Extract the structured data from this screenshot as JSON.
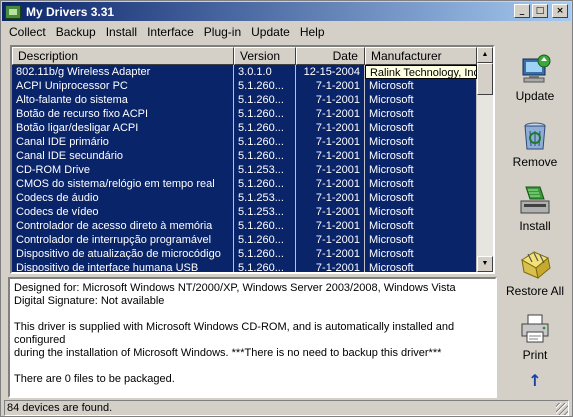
{
  "window": {
    "title": "My Drivers 3.31",
    "buttons": {
      "minimize": "_",
      "maximize": "□",
      "close": "×"
    }
  },
  "menu": [
    {
      "label": "Collect"
    },
    {
      "label": "Backup"
    },
    {
      "label": "Install"
    },
    {
      "label": "Interface"
    },
    {
      "label": "Plug-in"
    },
    {
      "label": "Update"
    },
    {
      "label": "Help"
    }
  ],
  "table": {
    "headers": [
      "Description",
      "Version",
      "Date",
      "Manufacturer"
    ],
    "rows": [
      [
        "802.11b/g Wireless Adapter",
        "3.0.1.0",
        "12-15-2004",
        "Ralink Technology, Inc."
      ],
      [
        "ACPI Uniprocessor PC",
        "5.1.260...",
        "7-1-2001",
        "Microsoft"
      ],
      [
        "Alto-falante do sistema",
        "5.1.260...",
        "7-1-2001",
        "Microsoft"
      ],
      [
        "Botão de recurso fixo ACPI",
        "5.1.260...",
        "7-1-2001",
        "Microsoft"
      ],
      [
        "Botão ligar/desligar ACPI",
        "5.1.260...",
        "7-1-2001",
        "Microsoft"
      ],
      [
        "Canal IDE primário",
        "5.1.260...",
        "7-1-2001",
        "Microsoft"
      ],
      [
        "Canal IDE secundário",
        "5.1.260...",
        "7-1-2001",
        "Microsoft"
      ],
      [
        "CD-ROM Drive",
        "5.1.253...",
        "7-1-2001",
        "Microsoft"
      ],
      [
        "CMOS do sistema/relógio em tempo real",
        "5.1.260...",
        "7-1-2001",
        "Microsoft"
      ],
      [
        "Codecs de áudio",
        "5.1.253...",
        "7-1-2001",
        "Microsoft"
      ],
      [
        "Codecs de vídeo",
        "5.1.253...",
        "7-1-2001",
        "Microsoft"
      ],
      [
        "Controlador de acesso direto à memória",
        "5.1.260...",
        "7-1-2001",
        "Microsoft"
      ],
      [
        "Controlador de interrupção programável",
        "5.1.260...",
        "7-1-2001",
        "Microsoft"
      ],
      [
        "Dispositivo de atualização de microcódigo",
        "5.1.260...",
        "7-1-2001",
        "Microsoft"
      ],
      [
        "Dispositivo de interface humana USB",
        "5.1.260...",
        "7-1-2001",
        "Microsoft"
      ]
    ]
  },
  "details": {
    "designed_for": "Designed for: Microsoft Windows NT/2000/XP, Windows Server 2003/2008, Windows Vista",
    "signature": "Digital Signature: Not available",
    "note_line1": "This driver is supplied with Microsoft Windows CD-ROM, and is automatically installed and configured",
    "note_line2": "during the installation of Microsoft Windows. ***There is no need to backup this driver***",
    "files": "There are 0 files to be packaged."
  },
  "toolbar": {
    "update": "Update",
    "remove": "Remove",
    "install": "Install",
    "restore": "Restore All",
    "print": "Print",
    "up_arrow": "↑"
  },
  "status": {
    "text": "84 devices are found."
  },
  "colors": {
    "selection": "#0a246a",
    "titlebar_start": "#0a246a",
    "titlebar_end": "#a6caf0"
  }
}
